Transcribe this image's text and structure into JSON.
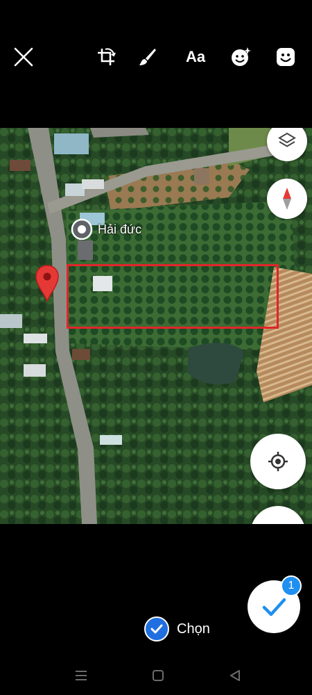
{
  "toolbar": {
    "text_tool_label": "Aa",
    "icons": [
      "close-icon",
      "crop-rotate-icon",
      "brush-icon",
      "text-icon",
      "sticker-sparkle-icon",
      "emoji-icon"
    ]
  },
  "map": {
    "place_name": "Hải đức",
    "controls": [
      "layers-icon",
      "compass-icon",
      "my-location-icon",
      "camera-icon"
    ],
    "colors": {
      "marker_red": "#e53935",
      "selection_red": "#e0252a"
    }
  },
  "footer": {
    "select_label": "Chọn",
    "badge_count": "1",
    "accent": "#1f6fe0"
  },
  "navbar": {
    "icons": [
      "menu-icon",
      "home-icon",
      "back-icon"
    ]
  }
}
